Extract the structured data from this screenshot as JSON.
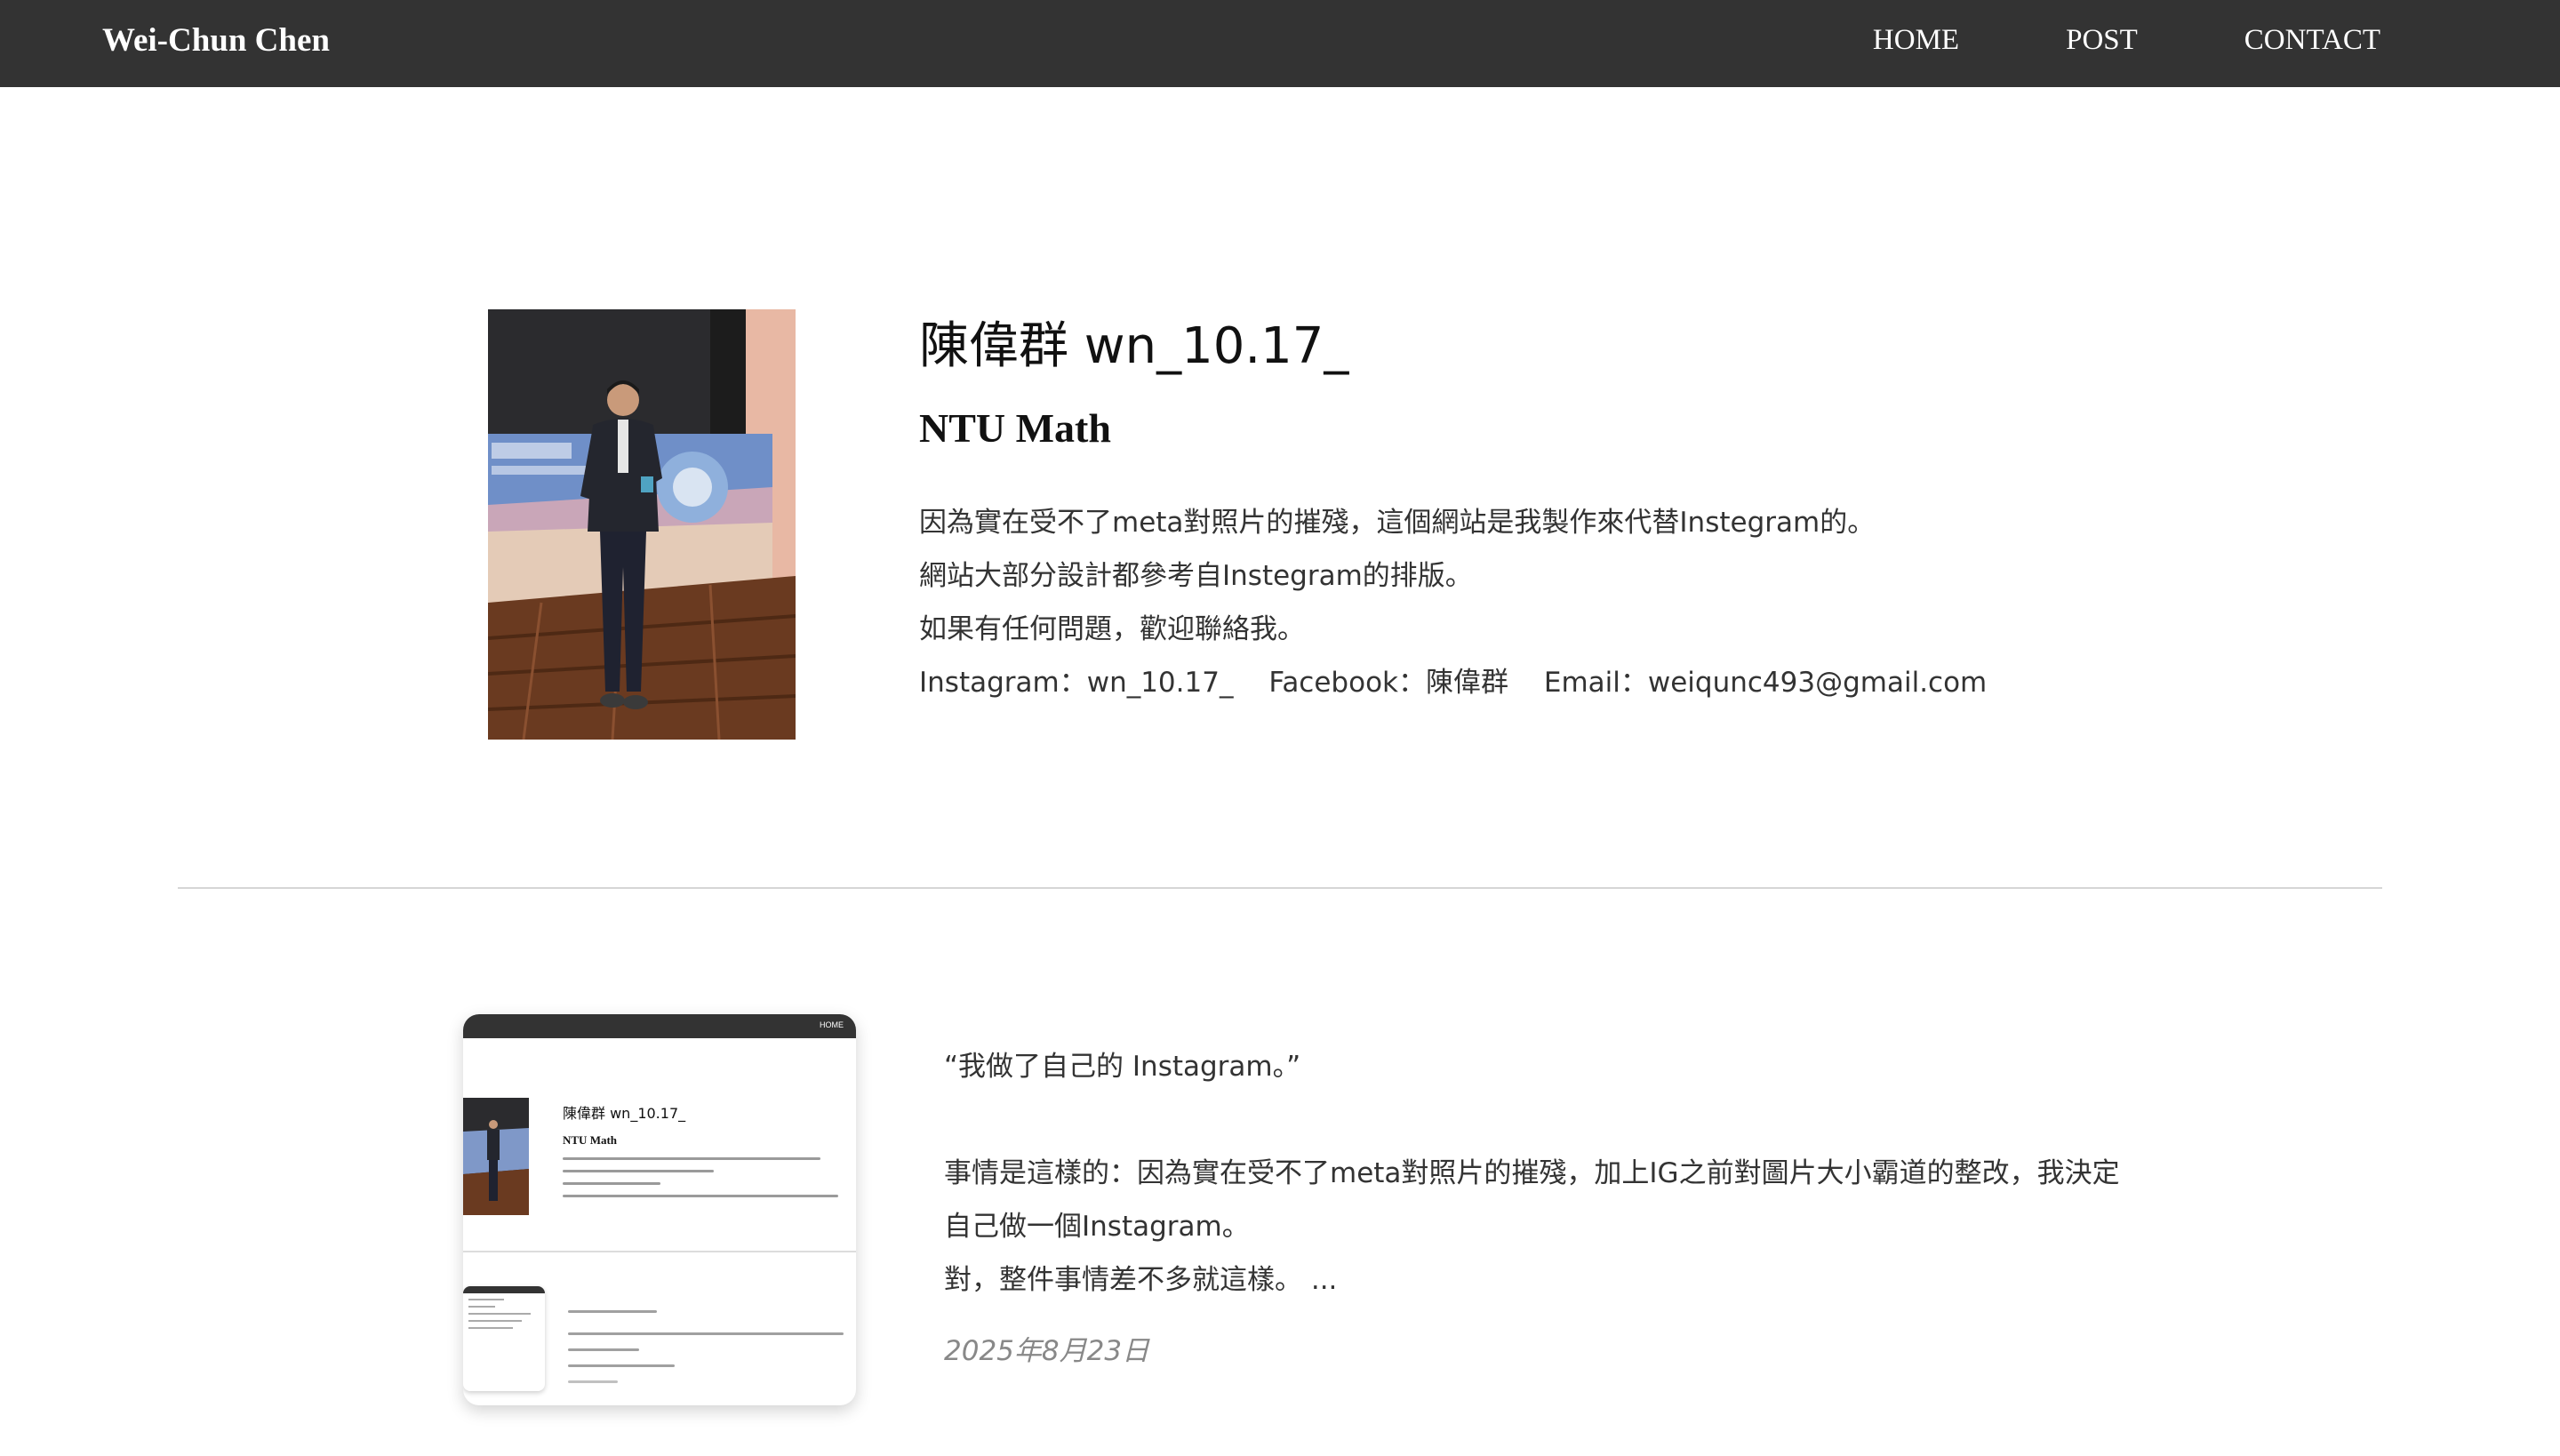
{
  "site": {
    "brand": "Wei-Chun Chen",
    "nav": [
      {
        "label": "HOME"
      },
      {
        "label": "POST"
      },
      {
        "label": "CONTACT"
      }
    ]
  },
  "profile": {
    "name": "陳偉群 wn_10.17_",
    "affiliation": "NTU Math",
    "bio": [
      "因為實在受不了meta對照片的摧殘，這個網站是我製作來代替Instegram的。",
      "網站大部分設計都參考自Instegram的排版。",
      "如果有任何問題，歡迎聯絡我。"
    ],
    "contact": {
      "instagram": "Instagram：wn_10.17_",
      "facebook": "Facebook：陳偉群",
      "email": "Email：weiqunc493@gmail.com"
    }
  },
  "post": {
    "quote": "“我做了自己的 Instagram。”",
    "excerpt": [
      "事情是這樣的：因為實在受不了meta對照片的摧殘，加上IG之前對圖片大小霸道的整改，我決定",
      "自己做一個Instagram。",
      "對，整件事情差不多就這樣。 ..."
    ],
    "date": "2025年8月23日",
    "thumbnail": {
      "home": "HOME",
      "name": "陳偉群 wn_10.17_",
      "affiliation": "NTU Math"
    }
  },
  "colors": {
    "navbar": "#333333",
    "text": "#333333",
    "muted": "#888888"
  }
}
